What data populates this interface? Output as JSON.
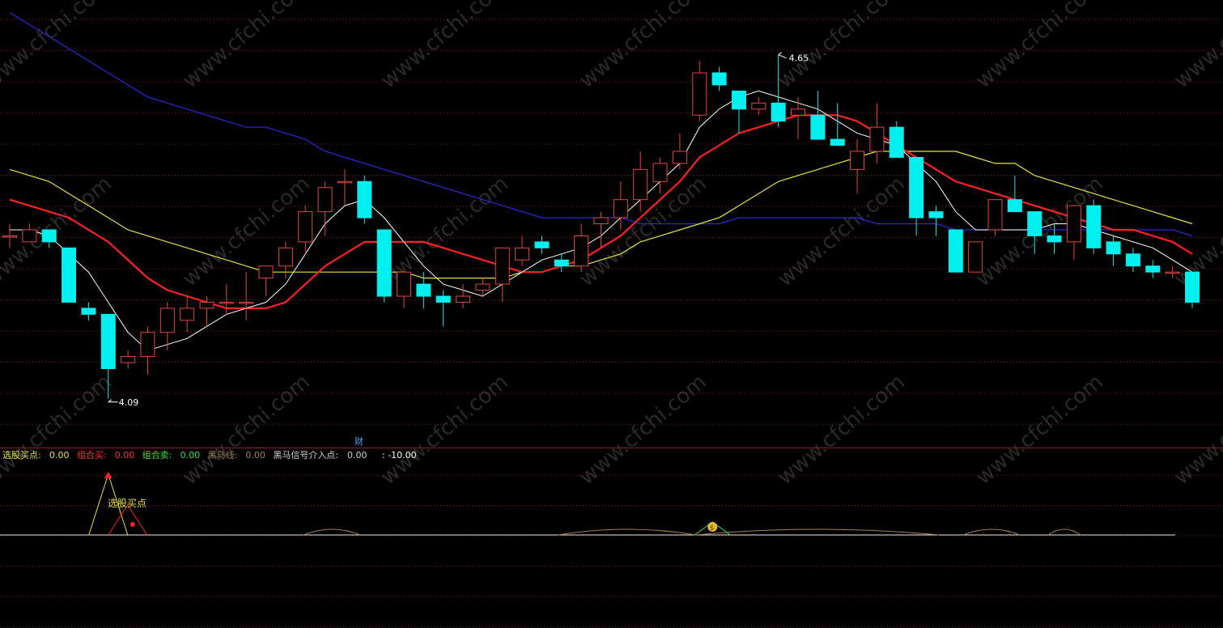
{
  "colors": {
    "background": "#000000",
    "up_candle": "#e0483c",
    "down_candle": "#00f0f0",
    "ma_fast": "#ffffff",
    "ma_mid": "#ff2020",
    "ma_slow": "#e8e040",
    "ma_long": "#2a2ad8",
    "grid": "#8a1f1f",
    "watermark": "#5a5a5a"
  },
  "watermark_text": "www.cfchi.com",
  "main": {
    "high_label": "4.65",
    "low_label": "4.09",
    "fin_marker": "财"
  },
  "indicator_legend": [
    {
      "label": "选股买点:",
      "value": "0.00",
      "color": "#e8e040"
    },
    {
      "label": "组合买:",
      "value": "0.00",
      "color": "#ff3030"
    },
    {
      "label": "组合卖:",
      "value": "0.00",
      "color": "#30e030"
    },
    {
      "label": "黑马线:",
      "value": "0.00",
      "color": "#a08050"
    },
    {
      "label": "黑马信号介入点:",
      "value": "0.00",
      "color": "#d0d0d0"
    }
  ],
  "indicator_extra": ": -10.00",
  "indicator_marker_label": "选股买点",
  "chart_data": {
    "type": "candlestick",
    "ylim": [
      4.02,
      4.74
    ],
    "candles": [
      {
        "o": 4.36,
        "h": 4.38,
        "l": 4.34,
        "c": 4.36
      },
      {
        "o": 4.35,
        "h": 4.38,
        "l": 4.35,
        "c": 4.37
      },
      {
        "o": 4.37,
        "h": 4.37,
        "l": 4.34,
        "c": 4.35
      },
      {
        "o": 4.34,
        "h": 4.34,
        "l": 4.25,
        "c": 4.25
      },
      {
        "o": 4.24,
        "h": 4.25,
        "l": 4.22,
        "c": 4.23
      },
      {
        "o": 4.23,
        "h": 4.23,
        "l": 4.09,
        "c": 4.14
      },
      {
        "o": 4.15,
        "h": 4.17,
        "l": 4.14,
        "c": 4.16
      },
      {
        "o": 4.16,
        "h": 4.21,
        "l": 4.13,
        "c": 4.2
      },
      {
        "o": 4.2,
        "h": 4.25,
        "l": 4.17,
        "c": 4.24
      },
      {
        "o": 4.22,
        "h": 4.26,
        "l": 4.2,
        "c": 4.24
      },
      {
        "o": 4.24,
        "h": 4.26,
        "l": 4.21,
        "c": 4.25
      },
      {
        "o": 4.25,
        "h": 4.28,
        "l": 4.23,
        "c": 4.25
      },
      {
        "o": 4.25,
        "h": 4.3,
        "l": 4.22,
        "c": 4.25
      },
      {
        "o": 4.29,
        "h": 4.31,
        "l": 4.26,
        "c": 4.31
      },
      {
        "o": 4.31,
        "h": 4.35,
        "l": 4.29,
        "c": 4.34
      },
      {
        "o": 4.35,
        "h": 4.41,
        "l": 4.33,
        "c": 4.4
      },
      {
        "o": 4.4,
        "h": 4.45,
        "l": 4.36,
        "c": 4.44
      },
      {
        "o": 4.45,
        "h": 4.47,
        "l": 4.41,
        "c": 4.45
      },
      {
        "o": 4.45,
        "h": 4.46,
        "l": 4.38,
        "c": 4.39
      },
      {
        "o": 4.37,
        "h": 4.37,
        "l": 4.25,
        "c": 4.26
      },
      {
        "o": 4.26,
        "h": 4.3,
        "l": 4.24,
        "c": 4.3
      },
      {
        "o": 4.28,
        "h": 4.3,
        "l": 4.24,
        "c": 4.26
      },
      {
        "o": 4.26,
        "h": 4.27,
        "l": 4.21,
        "c": 4.25
      },
      {
        "o": 4.25,
        "h": 4.28,
        "l": 4.24,
        "c": 4.26
      },
      {
        "o": 4.27,
        "h": 4.29,
        "l": 4.26,
        "c": 4.28
      },
      {
        "o": 4.28,
        "h": 4.34,
        "l": 4.25,
        "c": 4.34
      },
      {
        "o": 4.32,
        "h": 4.36,
        "l": 4.31,
        "c": 4.34
      },
      {
        "o": 4.35,
        "h": 4.36,
        "l": 4.33,
        "c": 4.34
      },
      {
        "o": 4.32,
        "h": 4.33,
        "l": 4.3,
        "c": 4.31
      },
      {
        "o": 4.31,
        "h": 4.38,
        "l": 4.3,
        "c": 4.36
      },
      {
        "o": 4.38,
        "h": 4.4,
        "l": 4.34,
        "c": 4.39
      },
      {
        "o": 4.39,
        "h": 4.45,
        "l": 4.37,
        "c": 4.42
      },
      {
        "o": 4.42,
        "h": 4.5,
        "l": 4.4,
        "c": 4.47
      },
      {
        "o": 4.45,
        "h": 4.49,
        "l": 4.43,
        "c": 4.48
      },
      {
        "o": 4.48,
        "h": 4.53,
        "l": 4.47,
        "c": 4.5
      },
      {
        "o": 4.56,
        "h": 4.65,
        "l": 4.55,
        "c": 4.63
      },
      {
        "o": 4.63,
        "h": 4.64,
        "l": 4.6,
        "c": 4.61
      },
      {
        "o": 4.6,
        "h": 4.6,
        "l": 4.53,
        "c": 4.57
      },
      {
        "o": 4.57,
        "h": 4.59,
        "l": 4.56,
        "c": 4.58
      },
      {
        "o": 4.58,
        "h": 4.66,
        "l": 4.54,
        "c": 4.55
      },
      {
        "o": 4.56,
        "h": 4.59,
        "l": 4.52,
        "c": 4.57
      },
      {
        "o": 4.56,
        "h": 4.6,
        "l": 4.52,
        "c": 4.52
      },
      {
        "o": 4.52,
        "h": 4.58,
        "l": 4.51,
        "c": 4.51
      },
      {
        "o": 4.47,
        "h": 4.52,
        "l": 4.43,
        "c": 4.5
      },
      {
        "o": 4.5,
        "h": 4.58,
        "l": 4.48,
        "c": 4.54
      },
      {
        "o": 4.54,
        "h": 4.55,
        "l": 4.49,
        "c": 4.49
      },
      {
        "o": 4.49,
        "h": 4.49,
        "l": 4.36,
        "c": 4.39
      },
      {
        "o": 4.4,
        "h": 4.41,
        "l": 4.36,
        "c": 4.39
      },
      {
        "o": 4.37,
        "h": 4.37,
        "l": 4.3,
        "c": 4.3
      },
      {
        "o": 4.3,
        "h": 4.35,
        "l": 4.3,
        "c": 4.35
      },
      {
        "o": 4.37,
        "h": 4.42,
        "l": 4.36,
        "c": 4.42
      },
      {
        "o": 4.42,
        "h": 4.46,
        "l": 4.4,
        "c": 4.4
      },
      {
        "o": 4.4,
        "h": 4.4,
        "l": 4.33,
        "c": 4.36
      },
      {
        "o": 4.36,
        "h": 4.38,
        "l": 4.33,
        "c": 4.35
      },
      {
        "o": 4.35,
        "h": 4.4,
        "l": 4.32,
        "c": 4.41
      },
      {
        "o": 4.41,
        "h": 4.42,
        "l": 4.33,
        "c": 4.34
      },
      {
        "o": 4.35,
        "h": 4.36,
        "l": 4.31,
        "c": 4.33
      },
      {
        "o": 4.33,
        "h": 4.34,
        "l": 4.3,
        "c": 4.31
      },
      {
        "o": 4.31,
        "h": 4.32,
        "l": 4.29,
        "c": 4.3
      },
      {
        "o": 4.3,
        "h": 4.31,
        "l": 4.29,
        "c": 4.3
      },
      {
        "o": 4.3,
        "h": 4.3,
        "l": 4.24,
        "c": 4.25
      }
    ],
    "ma_fast": [
      4.37,
      4.37,
      4.36,
      4.33,
      4.3,
      4.25,
      4.2,
      4.17,
      4.18,
      4.19,
      4.21,
      4.23,
      4.24,
      4.25,
      4.28,
      4.33,
      4.38,
      4.41,
      4.42,
      4.39,
      4.35,
      4.31,
      4.28,
      4.27,
      4.26,
      4.28,
      4.3,
      4.32,
      4.33,
      4.34,
      4.36,
      4.39,
      4.42,
      4.45,
      4.48,
      4.54,
      4.57,
      4.59,
      4.6,
      4.59,
      4.58,
      4.57,
      4.55,
      4.53,
      4.52,
      4.51,
      4.48,
      4.45,
      4.4,
      4.37,
      4.37,
      4.37,
      4.37,
      4.38,
      4.38,
      4.37,
      4.36,
      4.35,
      4.34,
      4.32,
      4.3
    ],
    "ma_mid": [
      4.42,
      4.41,
      4.4,
      4.39,
      4.37,
      4.35,
      4.32,
      4.29,
      4.27,
      4.26,
      4.25,
      4.24,
      4.24,
      4.24,
      4.25,
      4.28,
      4.31,
      4.33,
      4.35,
      4.35,
      4.35,
      4.35,
      4.34,
      4.33,
      4.32,
      4.31,
      4.3,
      4.3,
      4.31,
      4.32,
      4.34,
      4.36,
      4.39,
      4.42,
      4.45,
      4.49,
      4.51,
      4.53,
      4.54,
      4.55,
      4.56,
      4.56,
      4.56,
      4.55,
      4.53,
      4.51,
      4.49,
      4.47,
      4.45,
      4.44,
      4.43,
      4.42,
      4.41,
      4.4,
      4.39,
      4.38,
      4.37,
      4.37,
      4.36,
      4.35,
      4.33
    ],
    "ma_slow": [
      4.47,
      4.46,
      4.45,
      4.43,
      4.41,
      4.39,
      4.37,
      4.36,
      4.35,
      4.34,
      4.33,
      4.32,
      4.31,
      4.3,
      4.3,
      4.3,
      4.3,
      4.3,
      4.3,
      4.3,
      4.3,
      4.29,
      4.29,
      4.29,
      4.29,
      4.29,
      4.3,
      4.3,
      4.31,
      4.31,
      4.32,
      4.33,
      4.35,
      4.36,
      4.37,
      4.38,
      4.39,
      4.41,
      4.43,
      4.45,
      4.46,
      4.47,
      4.48,
      4.49,
      4.5,
      4.5,
      4.5,
      4.5,
      4.5,
      4.49,
      4.48,
      4.48,
      4.46,
      4.45,
      4.44,
      4.43,
      4.42,
      4.41,
      4.4,
      4.39,
      4.38
    ],
    "ma_long": [
      4.73,
      4.71,
      4.69,
      4.67,
      4.65,
      4.63,
      4.61,
      4.59,
      4.58,
      4.57,
      4.56,
      4.55,
      4.54,
      4.54,
      4.53,
      4.52,
      4.5,
      4.49,
      4.48,
      4.47,
      4.46,
      4.45,
      4.44,
      4.43,
      4.42,
      4.41,
      4.4,
      4.39,
      4.39,
      4.39,
      4.39,
      4.39,
      4.38,
      4.38,
      4.38,
      4.38,
      4.38,
      4.39,
      4.39,
      4.39,
      4.39,
      4.39,
      4.39,
      4.39,
      4.38,
      4.38,
      4.38,
      4.38,
      4.37,
      4.37,
      4.37,
      4.37,
      4.37,
      4.37,
      4.37,
      4.37,
      4.37,
      4.37,
      4.37,
      4.37,
      4.36
    ],
    "indicator": {
      "buy_point_index": 5,
      "signal_index": 35
    }
  }
}
